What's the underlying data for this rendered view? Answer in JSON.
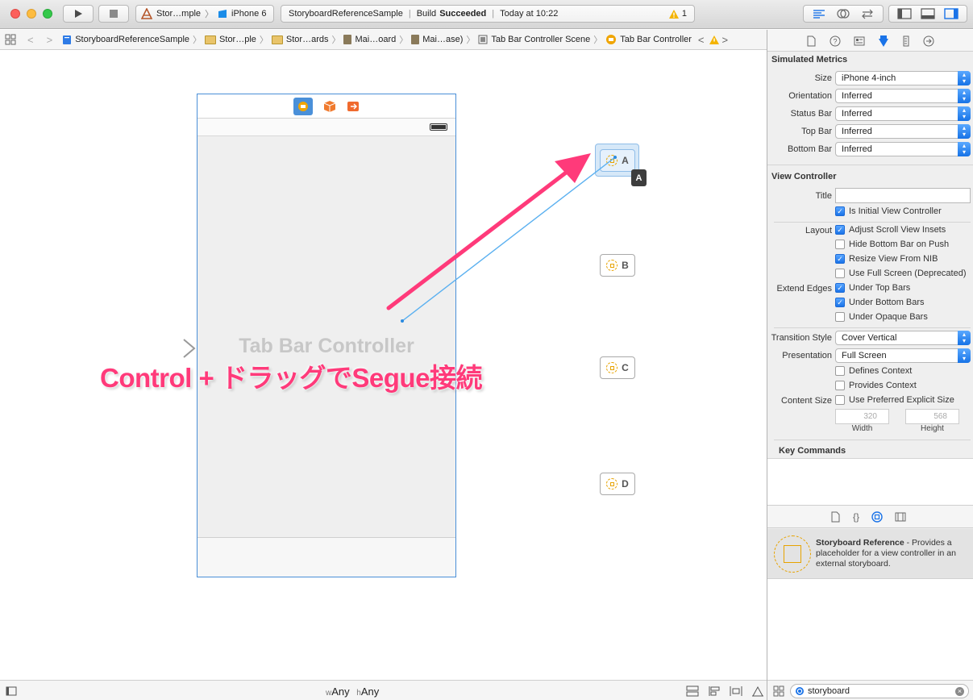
{
  "toolbar": {
    "scheme_name": "Stor…mple",
    "device": "iPhone 6",
    "project": "StoryboardReferenceSample",
    "build_label": "Build",
    "build_status": "Succeeded",
    "time": "Today at 10:22",
    "warning_count": "1"
  },
  "jumpbar": {
    "items": [
      "StoryboardReferenceSample",
      "Stor…ple",
      "Stor…ards",
      "Mai…oard",
      "Mai…ase)",
      "Tab Bar Controller Scene",
      "Tab Bar Controller"
    ]
  },
  "canvas": {
    "controller_title": "Tab Bar Controller",
    "annotation": "Control + ドラッグでSegue接続",
    "nodes": [
      "A",
      "B",
      "C",
      "D"
    ],
    "drag_badge": "A"
  },
  "statusbar": {
    "w_prefix": "w",
    "w_value": "Any",
    "h_prefix": "h",
    "h_value": "Any"
  },
  "inspector": {
    "simulated_metrics": {
      "title": "Simulated Metrics",
      "rows": [
        {
          "label": "Size",
          "value": "iPhone 4-inch"
        },
        {
          "label": "Orientation",
          "value": "Inferred"
        },
        {
          "label": "Status Bar",
          "value": "Inferred"
        },
        {
          "label": "Top Bar",
          "value": "Inferred"
        },
        {
          "label": "Bottom Bar",
          "value": "Inferred"
        }
      ]
    },
    "view_controller": {
      "title": "View Controller",
      "title_label": "Title",
      "title_value": "",
      "initial": "Is Initial View Controller",
      "layout_label": "Layout",
      "adjust": "Adjust Scroll View Insets",
      "hide_bottom": "Hide Bottom Bar on Push",
      "resize": "Resize View From NIB",
      "full_screen": "Use Full Screen (Deprecated)",
      "extend_label": "Extend Edges",
      "under_top": "Under Top Bars",
      "under_bottom": "Under Bottom Bars",
      "under_opaque": "Under Opaque Bars",
      "transition_label": "Transition Style",
      "transition_value": "Cover Vertical",
      "presentation_label": "Presentation",
      "presentation_value": "Full Screen",
      "defines_context": "Defines Context",
      "provides_context": "Provides Context",
      "content_size_label": "Content Size",
      "preferred_size": "Use Preferred Explicit Size",
      "width_value": "320",
      "height_value": "568",
      "width_label": "Width",
      "height_label": "Height"
    },
    "key_commands": "Key Commands"
  },
  "library": {
    "item_title": "Storyboard Reference",
    "item_desc": " - Provides a placeholder for a view controller in an external storyboard.",
    "filter_value": "storyboard"
  },
  "colors": {
    "annotation": "#ff3a7a",
    "selection_blue": "#2f80ed",
    "segue_line": "#5ab0f0"
  }
}
